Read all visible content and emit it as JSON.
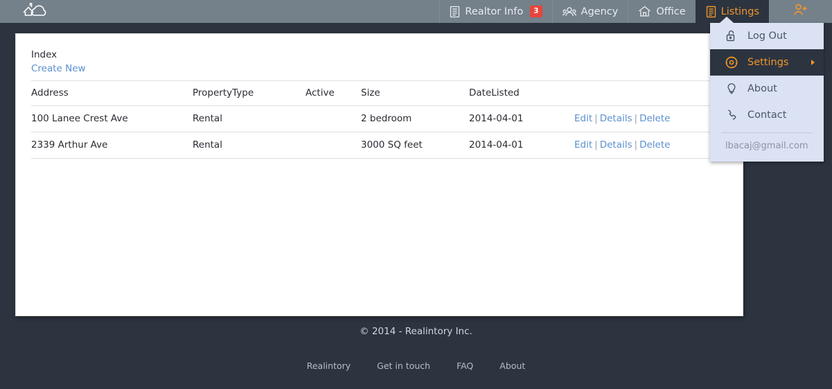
{
  "brand": {
    "logo_icon": "house-cloud-logo"
  },
  "nav": {
    "items": [
      {
        "label": "Realtor Info",
        "icon": "document-icon",
        "badge": "3",
        "active": false
      },
      {
        "label": "Agency",
        "icon": "people-icon",
        "badge": null,
        "active": false
      },
      {
        "label": "Office",
        "icon": "home-icon",
        "badge": null,
        "active": false
      },
      {
        "label": "Listings",
        "icon": "document-icon",
        "badge": null,
        "active": true
      }
    ],
    "user_icon": "add-user-icon"
  },
  "dropdown": {
    "items": [
      {
        "label": "Log Out",
        "icon": "unlock-icon",
        "selected": false,
        "submenu": false
      },
      {
        "label": "Settings",
        "icon": "gear-icon",
        "selected": true,
        "submenu": true
      },
      {
        "label": "About",
        "icon": "lightbulb-icon",
        "selected": false,
        "submenu": false
      },
      {
        "label": "Contact",
        "icon": "phone-icon",
        "selected": false,
        "submenu": false
      }
    ],
    "email": "lbacaj@gmail.com"
  },
  "main": {
    "title": "Index",
    "create_new_label": "Create New",
    "table": {
      "headers": [
        "Address",
        "PropertyType",
        "Active",
        "Size",
        "DateListed",
        ""
      ],
      "rows": [
        {
          "address": "100 Lanee Crest Ave",
          "property_type": "Rental",
          "active": "",
          "size": "2 bedroom",
          "date_listed": "2014-04-01",
          "actions": [
            "Edit",
            "Details",
            "Delete"
          ]
        },
        {
          "address": "2339 Arthur Ave",
          "property_type": "Rental",
          "active": "",
          "size": "3000 SQ feet",
          "date_listed": "2014-04-01",
          "actions": [
            "Edit",
            "Details",
            "Delete"
          ]
        }
      ],
      "action_separator": "|"
    }
  },
  "footer": {
    "copyright": "© 2014 - Realintory Inc.",
    "links": [
      "Realintory",
      "Get in touch",
      "FAQ",
      "About"
    ]
  },
  "colors": {
    "navbar": "#74808a",
    "page_background": "#2c3440",
    "accent_orange": "#f0962a",
    "badge_red": "#e8453c",
    "link_blue": "#5b8fd0",
    "dropdown_bg": "#dbe2f4"
  }
}
